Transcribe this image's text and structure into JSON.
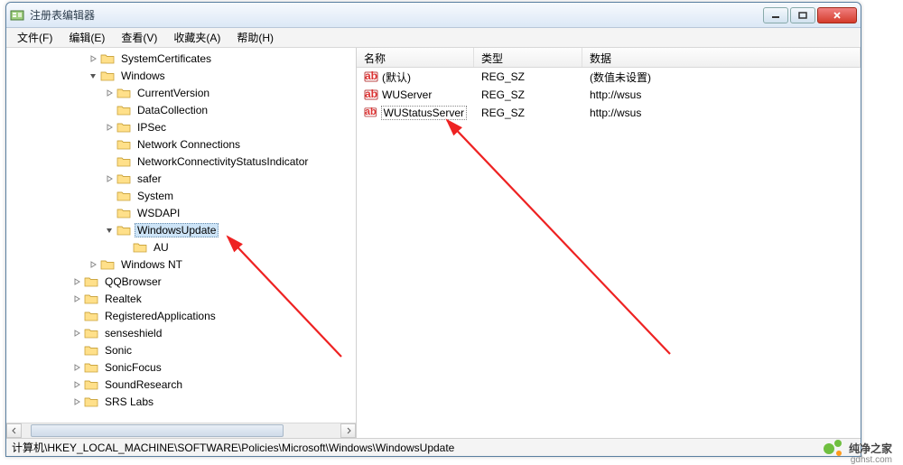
{
  "window": {
    "title": "注册表编辑器"
  },
  "menubar": {
    "items": [
      {
        "label": "文件(F)"
      },
      {
        "label": "编辑(E)"
      },
      {
        "label": "查看(V)"
      },
      {
        "label": "收藏夹(A)"
      },
      {
        "label": "帮助(H)"
      }
    ]
  },
  "tree": {
    "items": [
      {
        "indent": 5,
        "tw": "closed",
        "label": "SystemCertificates"
      },
      {
        "indent": 5,
        "tw": "open",
        "label": "Windows"
      },
      {
        "indent": 6,
        "tw": "closed",
        "label": "CurrentVersion"
      },
      {
        "indent": 6,
        "tw": "none",
        "label": "DataCollection"
      },
      {
        "indent": 6,
        "tw": "closed",
        "label": "IPSec"
      },
      {
        "indent": 6,
        "tw": "none",
        "label": "Network Connections"
      },
      {
        "indent": 6,
        "tw": "none",
        "label": "NetworkConnectivityStatusIndicator"
      },
      {
        "indent": 6,
        "tw": "closed",
        "label": "safer"
      },
      {
        "indent": 6,
        "tw": "none",
        "label": "System"
      },
      {
        "indent": 6,
        "tw": "none",
        "label": "WSDAPI"
      },
      {
        "indent": 6,
        "tw": "open",
        "label": "WindowsUpdate",
        "selected": true
      },
      {
        "indent": 7,
        "tw": "none",
        "label": "AU"
      },
      {
        "indent": 5,
        "tw": "closed",
        "label": "Windows NT"
      },
      {
        "indent": 4,
        "tw": "closed",
        "label": "QQBrowser"
      },
      {
        "indent": 4,
        "tw": "closed",
        "label": "Realtek"
      },
      {
        "indent": 4,
        "tw": "none",
        "label": "RegisteredApplications"
      },
      {
        "indent": 4,
        "tw": "closed",
        "label": "senseshield"
      },
      {
        "indent": 4,
        "tw": "none",
        "label": "Sonic"
      },
      {
        "indent": 4,
        "tw": "closed",
        "label": "SonicFocus"
      },
      {
        "indent": 4,
        "tw": "closed",
        "label": "SoundResearch"
      },
      {
        "indent": 4,
        "tw": "closed",
        "label": "SRS Labs"
      }
    ]
  },
  "list": {
    "columns": {
      "name": "名称",
      "type": "类型",
      "data": "数据"
    },
    "rows": [
      {
        "icon": "string",
        "name": "(默认)",
        "type": "REG_SZ",
        "data": "(数值未设置)"
      },
      {
        "icon": "string",
        "name": "WUServer",
        "type": "REG_SZ",
        "data": "http://wsus"
      },
      {
        "icon": "string",
        "name": "WUStatusServer",
        "type": "REG_SZ",
        "data": "http://wsus",
        "selected": true
      }
    ]
  },
  "statusbar": {
    "path": "计算机\\HKEY_LOCAL_MACHINE\\SOFTWARE\\Policies\\Microsoft\\Windows\\WindowsUpdate"
  },
  "watermark": {
    "brand": "纯净之家",
    "url": "gdhst.com"
  }
}
